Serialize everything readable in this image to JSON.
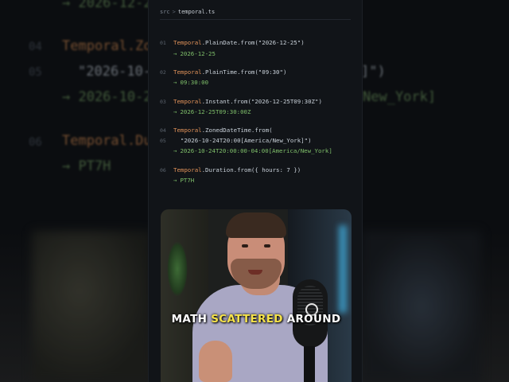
{
  "editor": {
    "breadcrumb": {
      "folder": "src",
      "separator": ">",
      "file": "temporal.ts"
    },
    "lines": [
      {
        "num": "01",
        "code_class": "Temporal",
        "code_rest": ".PlainDate.from(\"2026-12-25\")",
        "result": "2026-12-25"
      },
      {
        "num": "02",
        "code_class": "Temporal",
        "code_rest": ".PlainTime.from(\"09:30\")",
        "result": "09:30:00"
      },
      {
        "num": "03",
        "code_class": "Temporal",
        "code_rest": ".Instant.from(\"2026-12-25T09:30Z\")",
        "result": "2026-12-25T09:30:00Z"
      },
      {
        "num": "04",
        "code_class": "Temporal",
        "code_rest": ".ZonedDateTime.from(",
        "result": ""
      },
      {
        "num": "05",
        "code_class": "",
        "code_rest": "  \"2026-10-24T20:00[America/New_York]\")",
        "result": "2026-10-24T20:00:00-04:00[America/New_York]"
      },
      {
        "num": "06",
        "code_class": "Temporal",
        "code_rest": ".Duration.from({ hours: 7 })",
        "result": "PT7H"
      }
    ],
    "result_arrow": "→"
  },
  "background": {
    "top_result": "→ 2026-12-2",
    "line04": {
      "num": "04",
      "text": "Temporal.Zon"
    },
    "line05": {
      "num": "05",
      "text": "\"2026-10-",
      "tail": "]\")"
    },
    "line05_result": {
      "text": "→ 2026-10-2",
      "tail": "New_York]"
    },
    "line06": {
      "num": "06",
      "text": "Temporal.Du"
    },
    "line06_result": "→ PT7H"
  },
  "caption": {
    "part1": "MATH",
    "highlight": "SCATTERED",
    "part2": "AROUND"
  }
}
